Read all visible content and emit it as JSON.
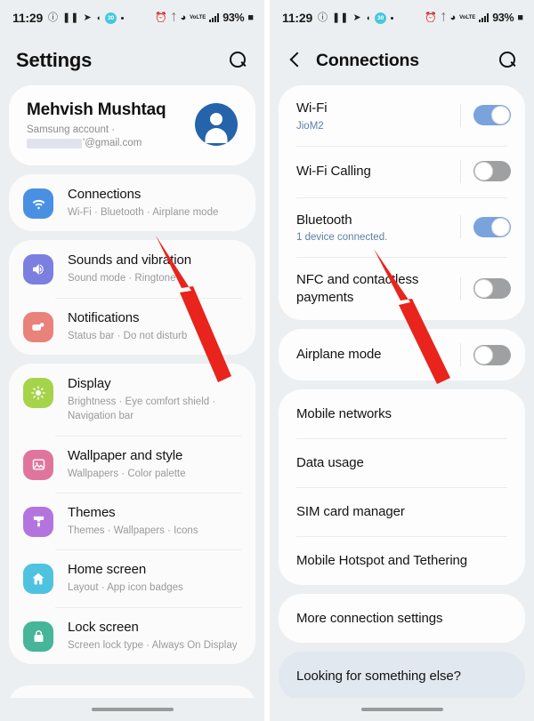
{
  "status_bar": {
    "time": "11:29",
    "battery": "93%",
    "left_icons": [
      "do-not-disturb-icon",
      "pause-icon",
      "telegram-icon",
      "snapchat-icon",
      "notification-badge-icon",
      "dot-icon"
    ],
    "badge_text": "30",
    "right_icons": [
      "alarm-icon",
      "bluetooth-icon",
      "wifi-icon",
      "volte-icon",
      "signal-bars-icon",
      "battery-icon"
    ],
    "volte_label": "VoLTE"
  },
  "left_screen": {
    "header": {
      "title": "Settings",
      "search_icon": "search-icon"
    },
    "profile": {
      "name": "Mehvish Mushtaq",
      "account_type": "Samsung account  ·",
      "email_suffix": "'@gmail.com",
      "avatar": "user-avatar-icon"
    },
    "groups": [
      {
        "items": [
          {
            "title": "Connections",
            "subtitle": "Wi-Fi  ·  Bluetooth  ·  Airplane mode",
            "icon": "wifi-icon",
            "icon_color": "#4a90e2"
          }
        ]
      },
      {
        "items": [
          {
            "title": "Sounds and vibration",
            "subtitle": "Sound mode  ·  Ringtone",
            "icon": "speaker-icon",
            "icon_color": "#7b7fe0"
          },
          {
            "title": "Notifications",
            "subtitle": "Status bar  ·  Do not disturb",
            "icon": "notification-bell-icon",
            "icon_color": "#e8827b"
          }
        ]
      },
      {
        "items": [
          {
            "title": "Display",
            "subtitle": "Brightness  ·  Eye comfort shield  ·  Navigation bar",
            "icon": "brightness-icon",
            "icon_color": "#a5d44a"
          },
          {
            "title": "Wallpaper and style",
            "subtitle": "Wallpapers  ·  Color palette",
            "icon": "image-icon",
            "icon_color": "#e0759c"
          },
          {
            "title": "Themes",
            "subtitle": "Themes  ·  Wallpapers  ·  Icons",
            "icon": "paintbrush-icon",
            "icon_color": "#b375dd"
          },
          {
            "title": "Home screen",
            "subtitle": "Layout  ·  App icon badges",
            "icon": "home-icon",
            "icon_color": "#4ec3e0"
          },
          {
            "title": "Lock screen",
            "subtitle": "Screen lock type  ·  Always On Display",
            "icon": "lock-icon",
            "icon_color": "#46b59a"
          }
        ]
      }
    ]
  },
  "right_screen": {
    "header": {
      "title": "Connections",
      "back_icon": "back-chevron-icon",
      "search_icon": "search-icon"
    },
    "toggle_group": [
      {
        "title": "Wi-Fi",
        "subtitle": "JioM2",
        "toggle_state": "on"
      },
      {
        "title": "Wi-Fi Calling",
        "subtitle": "",
        "toggle_state": "off"
      },
      {
        "title": "Bluetooth",
        "subtitle": "1 device connected.",
        "toggle_state": "on"
      },
      {
        "title": "NFC and contactless payments",
        "subtitle": "",
        "toggle_state": "off"
      }
    ],
    "airplane_group": [
      {
        "title": "Airplane mode",
        "subtitle": "",
        "toggle_state": "off"
      }
    ],
    "network_group": [
      "Mobile networks",
      "Data usage",
      "SIM card manager",
      "Mobile Hotspot and Tethering"
    ],
    "more_group": [
      "More connection settings"
    ],
    "looking_for": "Looking for something else?"
  },
  "annotations": {
    "arrow_color": "#e8241c",
    "arrows": [
      {
        "name": "arrow-to-connections",
        "target": "Connections row"
      },
      {
        "name": "arrow-to-bluetooth",
        "target": "Bluetooth row"
      }
    ]
  }
}
